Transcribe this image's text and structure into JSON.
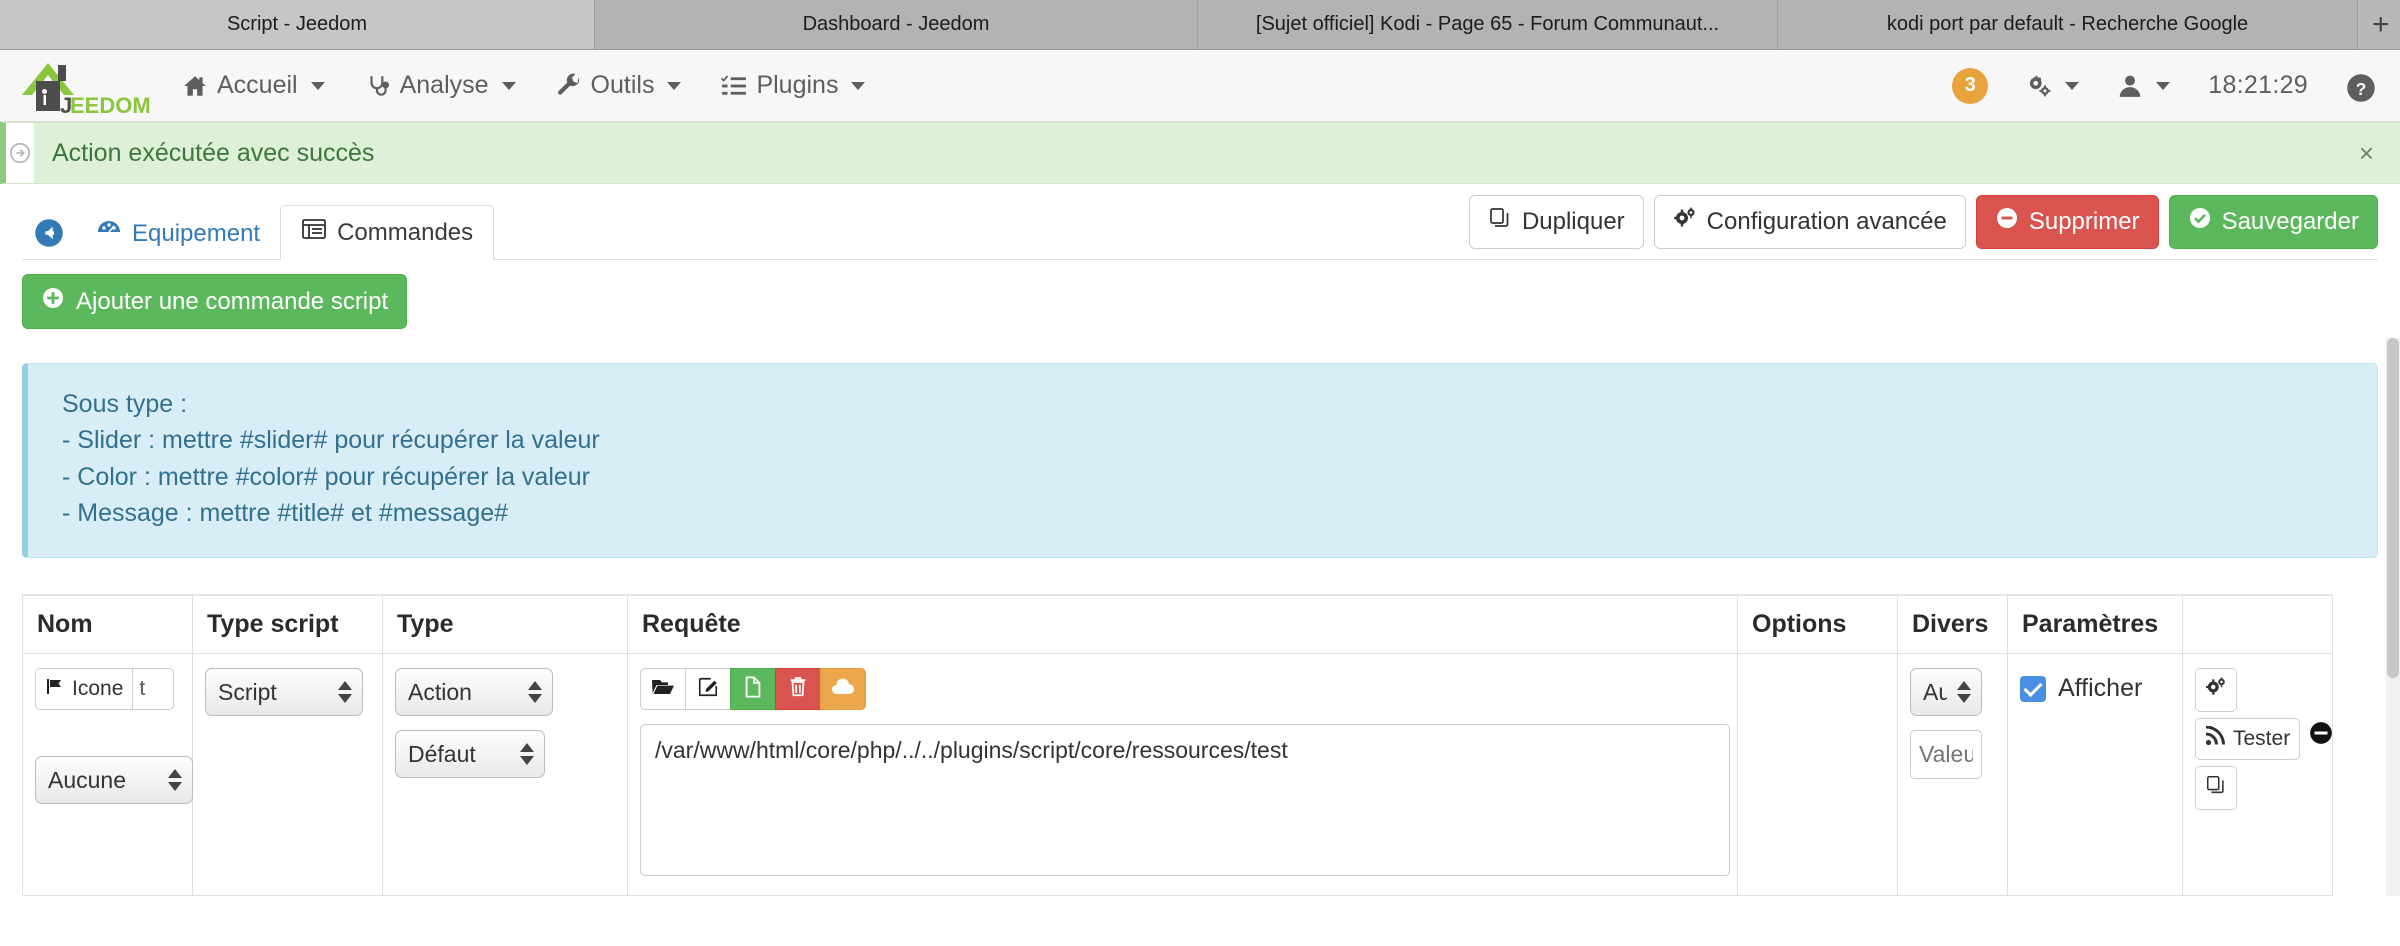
{
  "browser": {
    "tabs": [
      {
        "title": "Script - Jeedom",
        "active": false
      },
      {
        "title": "Dashboard - Jeedom",
        "active": true
      },
      {
        "title": "[Sujet officiel] Kodi - Page 65 - Forum Communaut...",
        "active": false
      },
      {
        "title": "kodi port par default - Recherche Google",
        "active": false
      }
    ],
    "new_tab_label": "+"
  },
  "navbar": {
    "logo_text_dark": "J",
    "logo_text_green": "EEDOM",
    "items": [
      {
        "label": "Accueil",
        "icon": "home-icon"
      },
      {
        "label": "Analyse",
        "icon": "stethoscope-icon"
      },
      {
        "label": "Outils",
        "icon": "wrench-icon"
      },
      {
        "label": "Plugins",
        "icon": "list-check-icon"
      }
    ],
    "notification_count": "3",
    "gear_icon": "gears-icon",
    "user_icon": "user-icon",
    "clock": "18:21:29",
    "help_icon": "question-circle-icon",
    "accent_orange": "#e8a33d"
  },
  "alert_success": {
    "message": "Action exécutée avec succès",
    "close_label": "×",
    "bg": "#dff0d8",
    "text_color": "#3c763d"
  },
  "page_tabs": {
    "back_icon": "arrow-circle-left-icon",
    "tabs": [
      {
        "label": "Equipement",
        "icon": "dashboard-icon",
        "active": false
      },
      {
        "label": "Commandes",
        "icon": "table-list-icon",
        "active": true
      }
    ],
    "actions": [
      {
        "label": "Dupliquer",
        "icon": "copy-icon",
        "style": "default"
      },
      {
        "label": "Configuration avancée",
        "icon": "gears-icon",
        "style": "default"
      },
      {
        "label": "Supprimer",
        "icon": "minus-circle-icon",
        "style": "danger"
      },
      {
        "label": "Sauvegarder",
        "icon": "check-circle-icon",
        "style": "success"
      }
    ]
  },
  "add_command": {
    "label": "Ajouter une commande script",
    "icon": "plus-circle-icon"
  },
  "info_box": {
    "lines": [
      "Sous type :",
      "- Slider : mettre #slider# pour récupérer la valeur",
      "- Color : mettre #color# pour récupérer la valeur",
      "- Message : mettre #title# et #message#"
    ]
  },
  "commands_table": {
    "headers": [
      "Nom",
      "Type script",
      "Type",
      "Requête",
      "Options",
      "Divers",
      "Paramètres",
      ""
    ],
    "rows": [
      {
        "nom": {
          "icone_button_label": "Icone",
          "icone_button_icon": "flag-icon",
          "name_value": "t",
          "icone_select_value": "Aucune"
        },
        "type_script": {
          "value": "Script"
        },
        "type": {
          "value": "Action",
          "subtype_value": "Défaut"
        },
        "requete": {
          "toolbar": [
            {
              "icon": "folder-open-icon",
              "style": "plain"
            },
            {
              "icon": "pencil-square-icon",
              "style": "plain"
            },
            {
              "icon": "file-icon",
              "style": "green"
            },
            {
              "icon": "trash-icon",
              "style": "red"
            },
            {
              "icon": "cloud-upload-icon",
              "style": "orange"
            }
          ],
          "value": "/var/www/html/core/php/../../plugins/script/core/ressources/test"
        },
        "options": {
          "value": ""
        },
        "divers": {
          "select_value": "Aucun",
          "input_placeholder": "Valeur"
        },
        "parametres": {
          "checkbox_label": "Afficher",
          "checked": true
        },
        "actions": {
          "config_icon": "gears-icon",
          "test_label": "Tester",
          "test_icon": "rss-icon",
          "duplicate_icon": "copy-icon",
          "remove_icon": "minus-circle-filled-icon"
        }
      }
    ]
  }
}
